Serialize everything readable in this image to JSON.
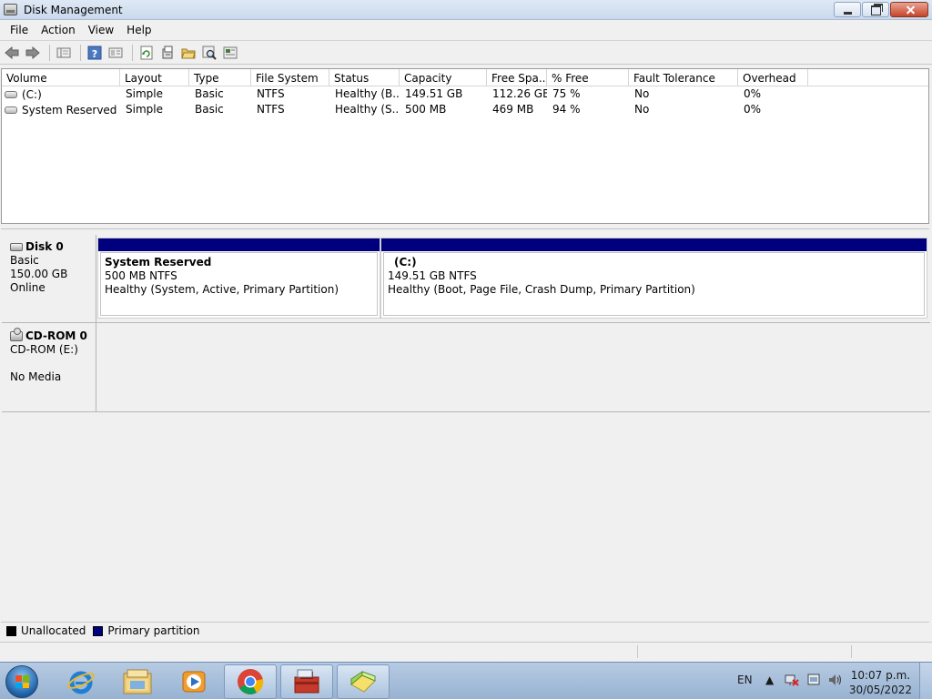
{
  "window": {
    "title": "Disk Management"
  },
  "menu": [
    "File",
    "Action",
    "View",
    "Help"
  ],
  "volume_table": {
    "columns": [
      "Volume",
      "Layout",
      "Type",
      "File System",
      "Status",
      "Capacity",
      "Free Spa...",
      "% Free",
      "Fault Tolerance",
      "Overhead"
    ],
    "rows": [
      [
        "(C:)",
        "Simple",
        "Basic",
        "NTFS",
        "Healthy (B...",
        "149.51 GB",
        "112.26 GB",
        "75 %",
        "No",
        "0%"
      ],
      [
        "System Reserved",
        "Simple",
        "Basic",
        "NTFS",
        "Healthy (S...",
        "500 MB",
        "469 MB",
        "94 %",
        "No",
        "0%"
      ]
    ]
  },
  "disks": [
    {
      "name": "Disk 0",
      "type": "Basic",
      "size": "150.00 GB",
      "state": "Online",
      "partitions": [
        {
          "name": "System Reserved",
          "size_fs": "500 MB NTFS",
          "status": "Healthy (System, Active, Primary Partition)"
        },
        {
          "name": "(C:)",
          "size_fs": "149.51 GB NTFS",
          "status": "Healthy (Boot, Page File, Crash Dump, Primary Partition)"
        }
      ]
    },
    {
      "name": "CD-ROM 0",
      "type": "CD-ROM (E:)",
      "state": "No Media"
    }
  ],
  "legend": [
    {
      "label": "Unallocated",
      "color": "#000000"
    },
    {
      "label": "Primary partition",
      "color": "#00007f"
    }
  ],
  "taskbar": {
    "language": "EN",
    "time": "10:07 p.m.",
    "date": "30/05/2022"
  },
  "colors": {
    "primary_partition": "#00007f",
    "title_bar": "#dfe9f5"
  },
  "icons": [
    "back-arrow-icon",
    "forward-arrow-icon",
    "properties-icon",
    "help-icon",
    "console-tree-icon",
    "refresh-icon",
    "rescan-disks-icon",
    "open-folder-icon",
    "search-icon",
    "settings-icon",
    "internet-explorer-icon",
    "windows-explorer-icon",
    "media-player-icon",
    "chrome-icon",
    "toolbox-icon",
    "disk-management-icon"
  ]
}
